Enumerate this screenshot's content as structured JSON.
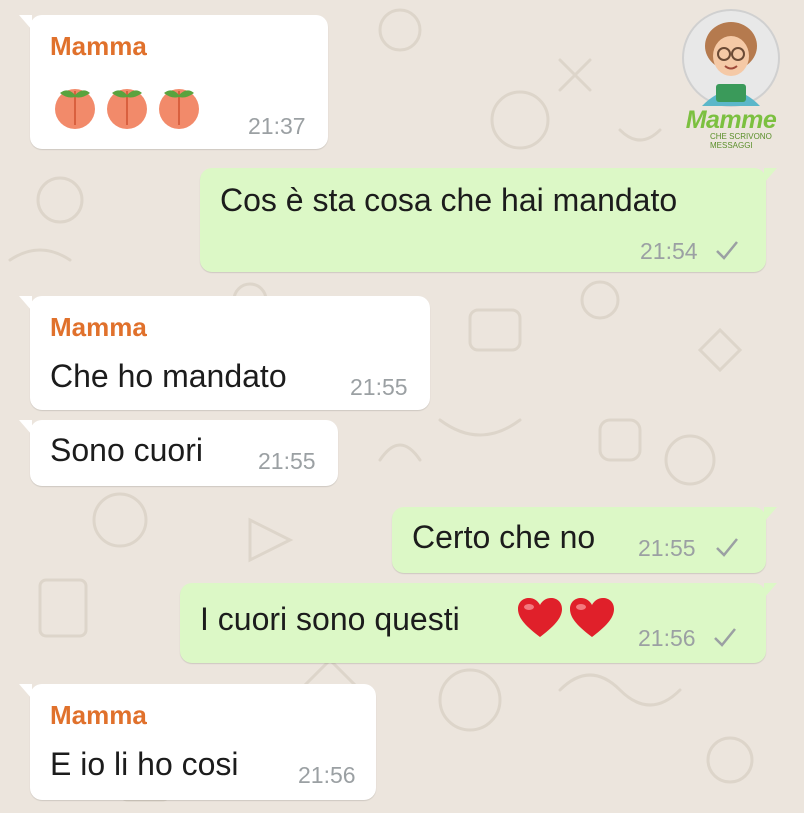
{
  "colors": {
    "chat_bg": "#ece5dd",
    "incoming": "#ffffff",
    "outgoing": "#dcf8c6",
    "sender": "#e0712c",
    "time": "#9ba0a3"
  },
  "watermark": {
    "title": "Mamme",
    "subtitle": "CHE SCRIVONO MESSAGGI"
  },
  "messages": [
    {
      "direction": "incoming",
      "sender": "Mamma",
      "emoji": [
        "peach-emoji",
        "peach-emoji",
        "peach-emoji"
      ],
      "time": "21:37"
    },
    {
      "direction": "outgoing",
      "text": "Cos è sta cosa che hai mandato",
      "time": "21:54",
      "status": "sent-check"
    },
    {
      "direction": "incoming",
      "sender": "Mamma",
      "text": "Che ho mandato",
      "time": "21:55"
    },
    {
      "direction": "incoming",
      "text": "Sono cuori",
      "time": "21:55"
    },
    {
      "direction": "outgoing",
      "text": "Certo che no",
      "time": "21:55",
      "status": "sent-check"
    },
    {
      "direction": "outgoing",
      "text": "I cuori sono questi",
      "emoji": [
        "red-heart-emoji",
        "red-heart-emoji"
      ],
      "time": "21:56",
      "status": "sent-check"
    },
    {
      "direction": "incoming",
      "sender": "Mamma",
      "text": "E io li ho cosi",
      "time": "21:56"
    }
  ]
}
